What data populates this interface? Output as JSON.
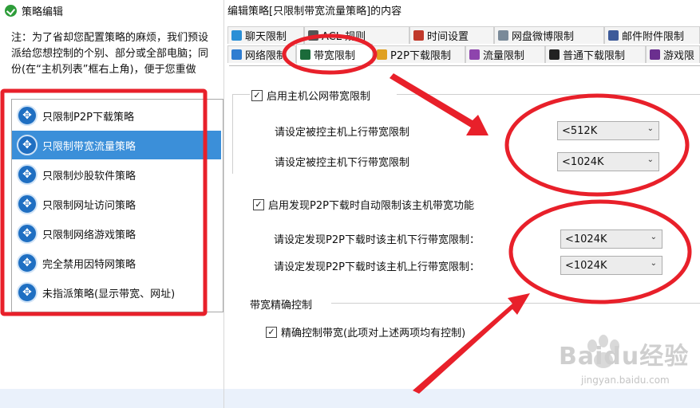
{
  "left_panel": {
    "title": "策略编辑",
    "intro_lines": [
      "注：为了省却您配置策略的麻烦，我们预设",
      "派给您想控制的个别、部分或全部电脑；同",
      "份(在“主机列表”框右上角)，便于您重做"
    ],
    "policies": [
      {
        "label": "只限制P2P下载策略",
        "selected": false
      },
      {
        "label": "只限制带宽流量策略",
        "selected": true
      },
      {
        "label": "只限制炒股软件策略",
        "selected": false
      },
      {
        "label": "只限制网址访问策略",
        "selected": false
      },
      {
        "label": "只限制网络游戏策略",
        "selected": false
      },
      {
        "label": "完全禁用因特网策略",
        "selected": false
      },
      {
        "label": "未指派策略(显示带宽、网址)",
        "selected": false
      }
    ]
  },
  "right_panel": {
    "title": "编辑策略[只限制带宽流量策略]的内容",
    "tabs_row1": [
      {
        "label": "聊天限制",
        "icon": "chat-icon"
      },
      {
        "label": "ACL 规则",
        "icon": "acl-icon"
      },
      {
        "label": "时间设置",
        "icon": "clock-icon"
      },
      {
        "label": "网盘微博限制",
        "icon": "cloud-icon"
      },
      {
        "label": "邮件附件限制",
        "icon": "mail-icon"
      }
    ],
    "tabs_row2": [
      {
        "label": "网络限制",
        "icon": "network-icon"
      },
      {
        "label": "带宽限制",
        "icon": "bandwidth-icon",
        "active": true
      },
      {
        "label": "P2P下载限制",
        "icon": "p2p-icon"
      },
      {
        "label": "流量限制",
        "icon": "traffic-icon"
      },
      {
        "label": "普通下载限制",
        "icon": "download-icon"
      },
      {
        "label": "游戏限",
        "icon": "game-icon"
      }
    ],
    "public_bandwidth": {
      "checkbox_label": "启用主机公网带宽限制",
      "checked": true,
      "upload_label": "请设定被控主机上行带宽限制",
      "upload_value": "<512K",
      "download_label": "请设定被控主机下行带宽限制",
      "download_value": "<1024K"
    },
    "p2p_auto": {
      "checkbox_label": "启用发现P2P下载时自动限制该主机带宽功能",
      "checked": true,
      "download_label": "请设定发现P2P下载时该主机下行带宽限制：",
      "download_value": "<1024K",
      "upload_label": "请设定发现P2P下载时该主机上行带宽限制：",
      "upload_value": "<1024K"
    },
    "precise": {
      "group_title": "带宽精确控制",
      "checkbox_label": "精确控制带宽(此项对上述两项均有控制)",
      "checked": true
    }
  },
  "watermark": {
    "brand": "Baidu经验",
    "url": "jingyan.baidu.com"
  },
  "colors": {
    "selection": "#3b8fd9",
    "annotation_red": "#e8202a",
    "policy_icon": "#1f6fc2"
  },
  "checkmark": "✓",
  "chevron": "⌄"
}
